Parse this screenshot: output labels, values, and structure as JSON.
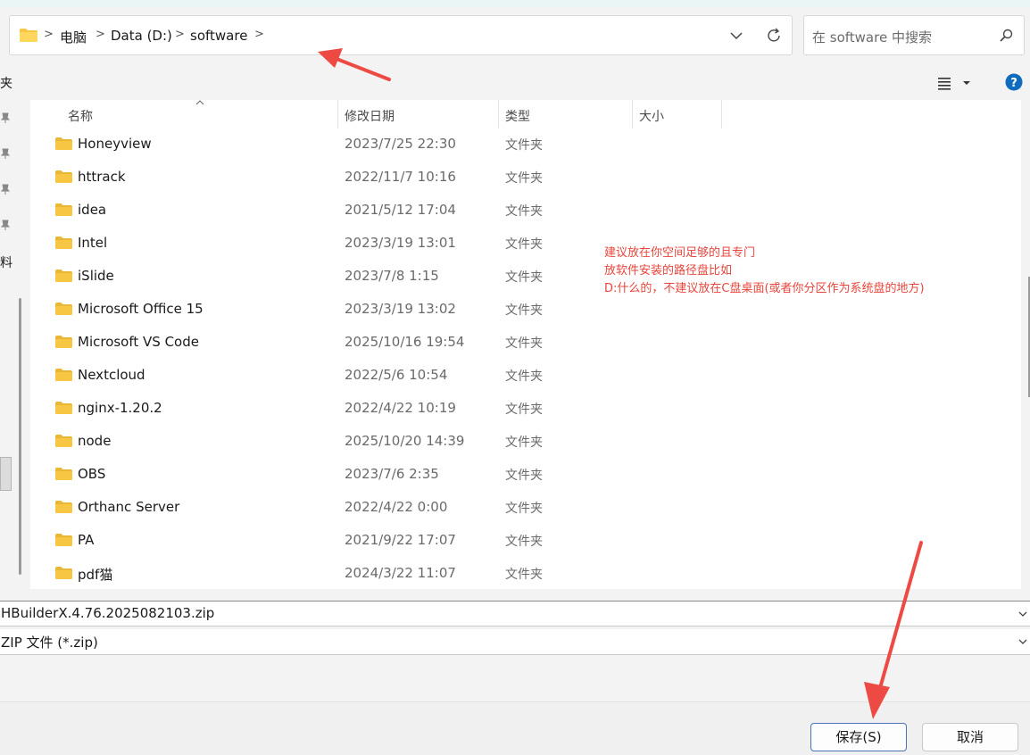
{
  "address": {
    "crumbs": [
      "电脑",
      "Data (D:)",
      "software"
    ],
    "separators": [
      ">",
      ">",
      ">",
      ">"
    ]
  },
  "search": {
    "placeholder": "在 software 中搜索"
  },
  "toolbar": {
    "left_text": "夹"
  },
  "nav": {
    "text": "料"
  },
  "columns": {
    "name": "名称",
    "date": "修改日期",
    "type": "类型",
    "size": "大小"
  },
  "files": [
    {
      "name": "Honeyview",
      "date": "2023/7/25 22:30",
      "type": "文件夹"
    },
    {
      "name": "httrack",
      "date": "2022/11/7 10:16",
      "type": "文件夹"
    },
    {
      "name": "idea",
      "date": "2021/5/12 17:04",
      "type": "文件夹"
    },
    {
      "name": "Intel",
      "date": "2023/3/19 13:01",
      "type": "文件夹"
    },
    {
      "name": "iSlide",
      "date": "2023/7/8 1:15",
      "type": "文件夹"
    },
    {
      "name": "Microsoft Office 15",
      "date": "2023/3/19 13:02",
      "type": "文件夹"
    },
    {
      "name": "Microsoft VS Code",
      "date": "2025/10/16 19:54",
      "type": "文件夹"
    },
    {
      "name": "Nextcloud",
      "date": "2022/5/6 10:54",
      "type": "文件夹"
    },
    {
      "name": "nginx-1.20.2",
      "date": "2022/4/22 10:19",
      "type": "文件夹"
    },
    {
      "name": "node",
      "date": "2025/10/20 14:39",
      "type": "文件夹"
    },
    {
      "name": "OBS",
      "date": "2023/7/6 2:35",
      "type": "文件夹"
    },
    {
      "name": "Orthanc Server",
      "date": "2022/4/22 0:00",
      "type": "文件夹"
    },
    {
      "name": "PA",
      "date": "2021/9/22 17:07",
      "type": "文件夹"
    },
    {
      "name": "pdf猫",
      "date": "2024/3/22 11:07",
      "type": "文件夹"
    }
  ],
  "annotation": {
    "lines": [
      "建议放在你空间足够的且专门",
      "放软件安装的路径盘比如",
      "D:什么的，不建议放在C盘桌面(或者你分区作为系统盘的地方)"
    ]
  },
  "fields": {
    "filename": "HBuilderX.4.76.2025082103.zip",
    "filetype": "ZIP 文件 (*.zip)"
  },
  "buttons": {
    "save": "保存(S)",
    "cancel": "取消"
  },
  "colors": {
    "folder": "#f7c642",
    "annotation": "#e8463c",
    "arrow": "#ee4a44",
    "accent": "#0f6cbd"
  },
  "icons": [
    "folder-icon",
    "chevron-right-icon",
    "chevron-down-icon",
    "refresh-icon",
    "search-icon",
    "view-list-icon",
    "help-icon",
    "pin-icon",
    "sort-caret-icon"
  ]
}
